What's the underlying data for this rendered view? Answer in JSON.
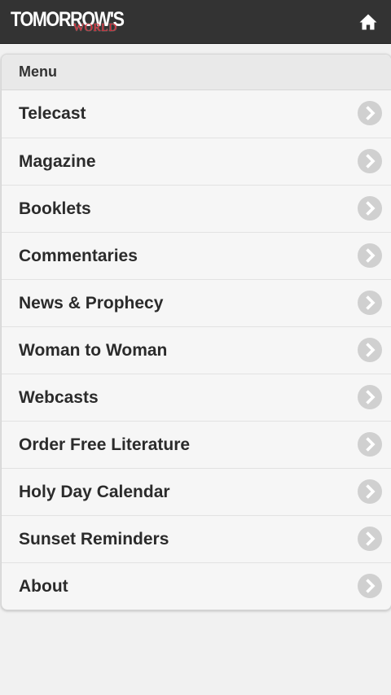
{
  "app": {
    "logo_main": "TOMORROW'S",
    "logo_sub": "WORLD",
    "home_icon": "home-icon"
  },
  "colors": {
    "header_bg": "#333333",
    "logo_accent": "#d81e2a",
    "chevron_bg": "#d0d0d0",
    "page_bg": "#f1f1f1"
  },
  "menu": {
    "title": "Menu",
    "chevron_icon": "chevron-right-icon",
    "items": [
      {
        "label": "Telecast"
      },
      {
        "label": "Magazine"
      },
      {
        "label": "Booklets"
      },
      {
        "label": "Commentaries"
      },
      {
        "label": "News & Prophecy"
      },
      {
        "label": "Woman to Woman"
      },
      {
        "label": "Webcasts"
      },
      {
        "label": "Order Free Literature"
      },
      {
        "label": "Holy Day Calendar"
      },
      {
        "label": "Sunset Reminders"
      },
      {
        "label": "About"
      }
    ]
  }
}
